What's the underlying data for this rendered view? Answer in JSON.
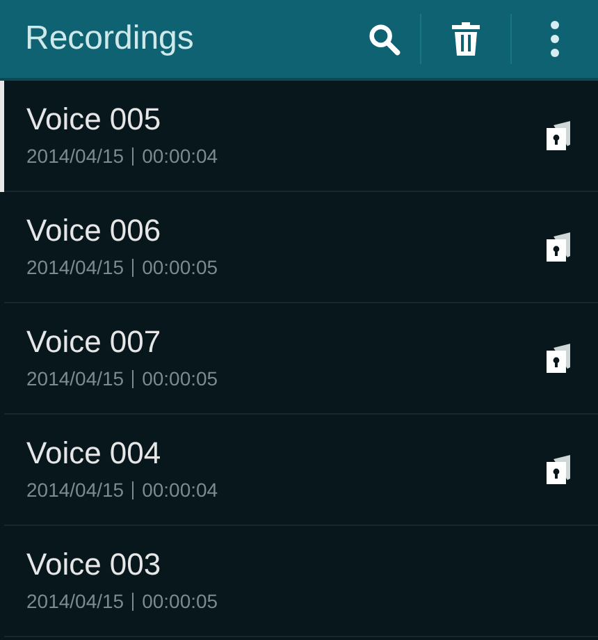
{
  "app_bar": {
    "title": "Recordings"
  },
  "recordings": [
    {
      "name": "Voice 005",
      "date": "2014/04/15",
      "duration": "00:00:04",
      "protected": true
    },
    {
      "name": "Voice 006",
      "date": "2014/04/15",
      "duration": "00:00:05",
      "protected": true
    },
    {
      "name": "Voice 007",
      "date": "2014/04/15",
      "duration": "00:00:05",
      "protected": true
    },
    {
      "name": "Voice 004",
      "date": "2014/04/15",
      "duration": "00:00:04",
      "protected": true
    },
    {
      "name": "Voice 003",
      "date": "2014/04/15",
      "duration": "00:00:05",
      "protected": false
    }
  ]
}
